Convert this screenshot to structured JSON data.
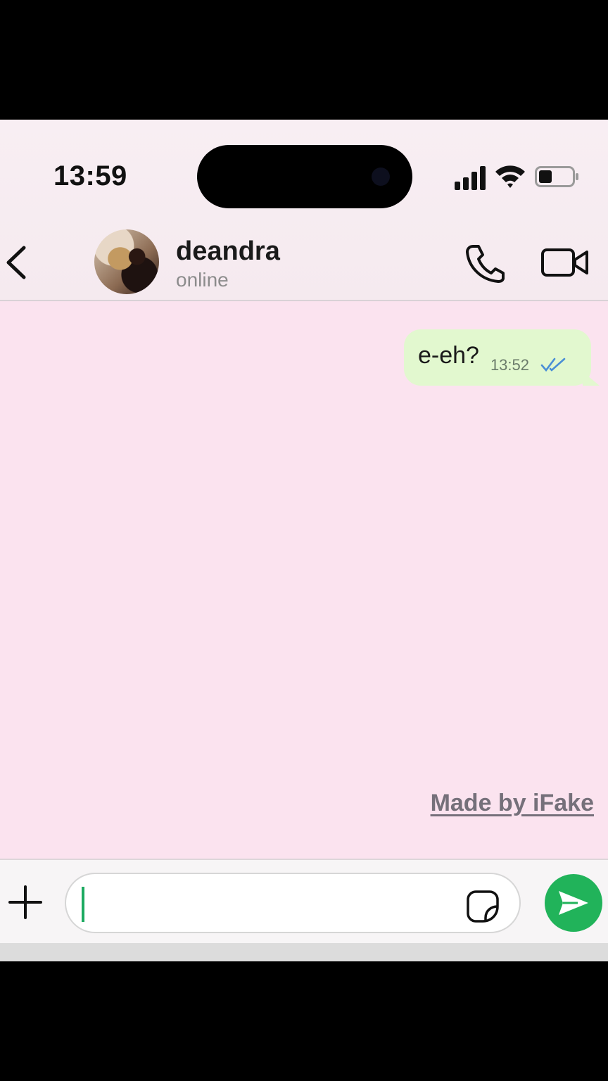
{
  "status_bar": {
    "time": "13:59"
  },
  "header": {
    "contact_name": "deandra",
    "contact_status": "online"
  },
  "messages": [
    {
      "direction": "outgoing",
      "text": "e-eh?",
      "time": "13:52",
      "status": "read"
    }
  ],
  "watermark": "Made by iFake",
  "composer": {
    "value": "",
    "placeholder": ""
  },
  "colors": {
    "chat_background": "#fbe3ef",
    "outgoing_bubble": "#e2f8cf",
    "send_button": "#21b35a",
    "read_ticks": "#4a8fd6"
  },
  "icons": [
    "back-chevron-icon",
    "phone-icon",
    "video-camera-icon",
    "plus-icon",
    "sticker-icon",
    "send-icon",
    "signal-icon",
    "wifi-icon",
    "battery-icon",
    "read-receipt-icon"
  ]
}
